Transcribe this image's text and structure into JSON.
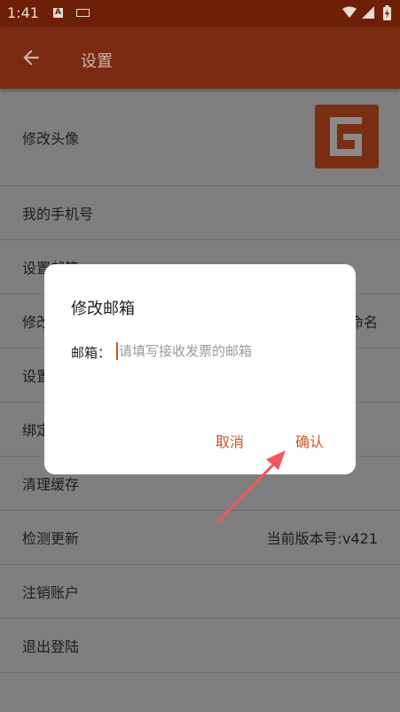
{
  "status_bar": {
    "time": "1:41",
    "notif_icon_label": "A"
  },
  "toolbar": {
    "title": "设置"
  },
  "settings": {
    "avatar_label": "修改头像",
    "phone_label": "我的手机号",
    "row3_label": "设置邮箱",
    "row4_label": "修改",
    "row4_value": "命名",
    "row5_label": "设置",
    "row6_label": "绑定",
    "cache_label": "清理缓存",
    "update_label": "检测更新",
    "version_value": "当前版本号:v421",
    "cancel_account_label": "注销账户",
    "logout_label": "退出登陆"
  },
  "dialog": {
    "title": "修改邮箱",
    "field_label": "邮箱：",
    "field_value": "",
    "field_placeholder": "请填写接收发票的邮箱",
    "cancel_label": "取消",
    "confirm_label": "确认"
  },
  "colors": {
    "brand": "#d3541c",
    "toolbar_dimmed": "#7a2a10",
    "status_dimmed": "#6e1f07",
    "annotation_arrow": "#f2565f"
  },
  "icons": {
    "back": "arrow-left-icon",
    "avatar": "app-logo-icon",
    "wifi": "wifi-icon",
    "signal": "signal-icon",
    "battery": "battery-charging-icon",
    "keyboard": "keyboard-icon"
  }
}
